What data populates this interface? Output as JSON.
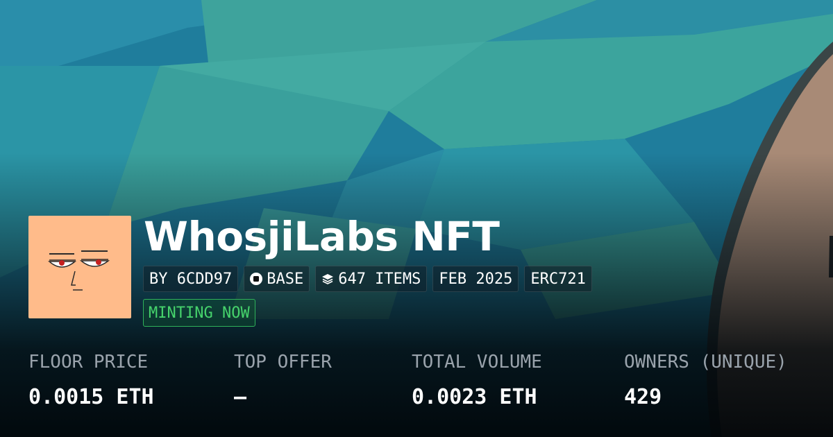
{
  "collection": {
    "title": "WhosjiLabs NFT",
    "creator": "BY 6CDD97",
    "chain": "BASE",
    "items": "647 ITEMS",
    "date": "FEB 2025",
    "standard": "ERC721",
    "status": "MINTING NOW"
  },
  "icons": {
    "chain": "base-chain-icon",
    "items": "layers-icon"
  },
  "stats": [
    {
      "label": "FLOOR PRICE",
      "value": "0.0015 ETH"
    },
    {
      "label": "TOP OFFER",
      "value": "—"
    },
    {
      "label": "TOTAL VOLUME",
      "value": "0.0023 ETH"
    },
    {
      "label": "OWNERS (UNIQUE)",
      "value": "429"
    }
  ],
  "colors": {
    "status_green": "#46d36c",
    "avatar_bg": "#ffbb8a",
    "bg_teal": "#3ea39c",
    "bg_blue": "#1f7d9c"
  }
}
